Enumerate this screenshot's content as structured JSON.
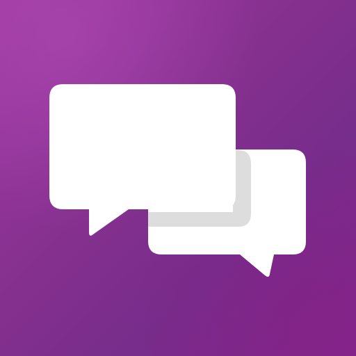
{
  "icon": {
    "name": "chat-bubbles-icon",
    "description_label": "",
    "colors": {
      "background_primary": "#8a2f94",
      "background_secondary": "#7b2d8c",
      "bubble_fill": "#ffffff",
      "bubble_shadow": "#dddddd"
    }
  }
}
